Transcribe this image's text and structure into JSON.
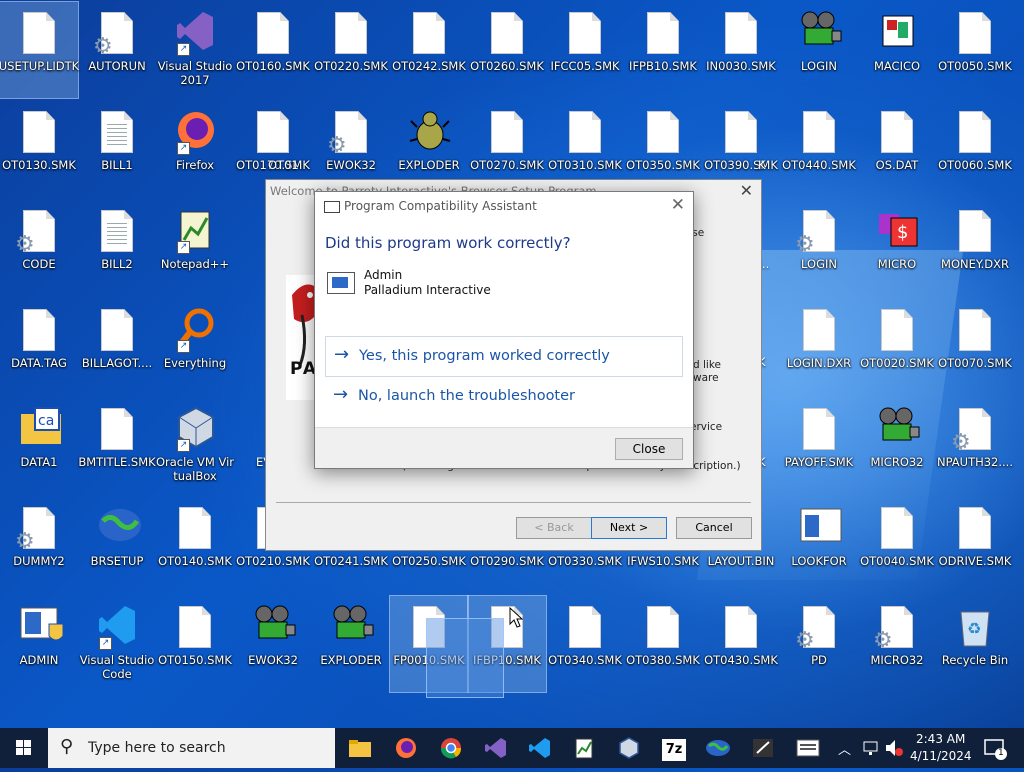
{
  "desktop": {
    "icons": [
      {
        "label": "USETUP.LIDTK",
        "icon": "file-icon"
      },
      {
        "label": "AUTORUN",
        "icon": "settings-file-icon"
      },
      {
        "label": "Visual Studio 2017",
        "icon": "visual-studio-icon"
      },
      {
        "label": "OT0160.SMK",
        "icon": "file-icon"
      },
      {
        "label": "OT0220.SMK",
        "icon": "file-icon"
      },
      {
        "label": "OT0242.SMK",
        "icon": "file-icon"
      },
      {
        "label": "OT0260.SMK",
        "icon": "file-icon"
      },
      {
        "label": "IFCC05.SMK",
        "icon": "file-icon"
      },
      {
        "label": "IFPB10.SMK",
        "icon": "file-icon"
      },
      {
        "label": "IN0030.SMK",
        "icon": "file-icon"
      },
      {
        "label": "LOGIN",
        "icon": "film-projector-icon"
      },
      {
        "label": "MACICO",
        "icon": "macico-icon"
      },
      {
        "label": "OT0050.SMK",
        "icon": "file-icon"
      },
      {
        "label": "OT0130.SMK",
        "icon": "file-icon"
      },
      {
        "label": "BILL1",
        "icon": "text-file-icon"
      },
      {
        "label": "Firefox",
        "icon": "firefox-icon"
      },
      {
        "label": "OT0170.SMK",
        "icon": "file-icon"
      },
      {
        "label": "EWOK32",
        "icon": "settings-file-icon"
      },
      {
        "label": "EXPLODER",
        "icon": "bug-icon"
      },
      {
        "label": "OT0270.SMK",
        "icon": "file-icon"
      },
      {
        "label": "OT0310.SMK",
        "icon": "file-icon"
      },
      {
        "label": "OT0350.SMK",
        "icon": "file-icon"
      },
      {
        "label": "OT0390.SMK",
        "icon": "file-icon"
      },
      {
        "label": "OT0440.SMK",
        "icon": "file-icon"
      },
      {
        "label": "OS.DAT",
        "icon": "file-icon"
      },
      {
        "label": "OT0060.SMK",
        "icon": "file-icon"
      },
      {
        "label": "CODE",
        "icon": "settings-file-icon"
      },
      {
        "label": "BILL2",
        "icon": "text-file-icon"
      },
      {
        "label": "Notepad++",
        "icon": "notepad-plus-plus-icon"
      },
      {
        "label": "LOGIN",
        "icon": "settings-file-icon"
      },
      {
        "label": "MICRO",
        "icon": "micro-icon"
      },
      {
        "label": "MONEY.DXR",
        "icon": "file-icon"
      },
      {
        "label": "DATA.TAG",
        "icon": "file-icon"
      },
      {
        "label": "BILLAGOT....",
        "icon": "file-icon"
      },
      {
        "label": "Everything",
        "icon": "everything-search-icon"
      },
      {
        "label": "LOGIN.DXR",
        "icon": "file-icon"
      },
      {
        "label": "OT0020.SMK",
        "icon": "file-icon"
      },
      {
        "label": "OT0070.SMK",
        "icon": "file-icon"
      },
      {
        "label": "DATA1",
        "icon": "folder-ca-icon"
      },
      {
        "label": "BMTITLE.SMK",
        "icon": "file-icon"
      },
      {
        "label": "Oracle VM VirtualBox",
        "icon": "virtualbox-icon"
      },
      {
        "label": "PAYOFF.SMK",
        "icon": "file-icon"
      },
      {
        "label": "MICRO32",
        "icon": "film-projector-icon"
      },
      {
        "label": "NPAUTH32....",
        "icon": "settings-file-icon"
      },
      {
        "label": "DUMMY2",
        "icon": "settings-file-icon"
      },
      {
        "label": "BRSETUP",
        "icon": "globe-icon"
      },
      {
        "label": "OT0140.SMK",
        "icon": "file-icon"
      },
      {
        "label": "OT0210.SMK",
        "icon": "file-icon"
      },
      {
        "label": "OT0241.SMK",
        "icon": "file-icon"
      },
      {
        "label": "OT0250.SMK",
        "icon": "file-icon"
      },
      {
        "label": "OT0290.SMK",
        "icon": "file-icon"
      },
      {
        "label": "OT0330.SMK",
        "icon": "file-icon"
      },
      {
        "label": "IFWS10.SMK",
        "icon": "file-icon"
      },
      {
        "label": "LAYOUT.BIN",
        "icon": "file-icon"
      },
      {
        "label": "LOOKFOR",
        "icon": "window-app-icon"
      },
      {
        "label": "OT0040.SMK",
        "icon": "file-icon"
      },
      {
        "label": "ODRIVE.SMK",
        "icon": "file-icon"
      },
      {
        "label": "ADMIN",
        "icon": "shield-window-icon"
      },
      {
        "label": "Visual Studio Code",
        "icon": "vscode-icon"
      },
      {
        "label": "OT0150.SMK",
        "icon": "file-icon"
      },
      {
        "label": "EWOK32",
        "icon": "film-projector-icon"
      },
      {
        "label": "EXPLODER",
        "icon": "film-projector-icon"
      },
      {
        "label": "FP0010.SMK",
        "icon": "file-icon"
      },
      {
        "label": "IFBP10.SMK",
        "icon": "file-icon"
      },
      {
        "label": "OT0340.SMK",
        "icon": "file-icon"
      },
      {
        "label": "OT0380.SMK",
        "icon": "file-icon"
      },
      {
        "label": "OT0430.SMK",
        "icon": "file-icon"
      },
      {
        "label": "PD",
        "icon": "settings-file-icon"
      },
      {
        "label": "MICRO32",
        "icon": "settings-file-icon"
      },
      {
        "label": "Recycle Bin",
        "icon": "recycle-bin-icon"
      }
    ],
    "partial_labels": [
      "OT01",
      "OT01",
      "OT01",
      "EV",
      "M..",
      "K",
      "K",
      "K"
    ]
  },
  "setup_window": {
    "title": "Welcome to Parroty Interactive's Browser Setup Program",
    "side_texts": [
      "r use",
      "d like",
      "ware",
      "ervice"
    ],
    "bottom_note": "(Installing the browser does not require a monthly subscription.)",
    "logo_text": "PA",
    "back_label": "< Back",
    "next_label": "Next >",
    "cancel_label": "Cancel"
  },
  "pca_dialog": {
    "title": "Program Compatibility Assistant",
    "question": "Did this program work correctly?",
    "app_name": "Admin",
    "publisher": "Palladium Interactive",
    "option_yes": "Yes, this program worked correctly",
    "option_no": "No, launch the troubleshooter",
    "close_label": "Close",
    "arrow_glyph": "→"
  },
  "taskbar": {
    "search_placeholder": "Type here to search",
    "apps": [
      "file-explorer-icon",
      "firefox-icon",
      "chrome-icon",
      "visual-studio-icon",
      "vscode-icon",
      "notepad-plus-plus-icon",
      "virtualbox-icon",
      "7zip-icon",
      "brsetup-globe-icon",
      "terminal-icon",
      "window-app-icon"
    ],
    "seven_zip_text": "7z",
    "time": "2:43 AM",
    "date": "4/11/2024",
    "notification_count": "1"
  }
}
